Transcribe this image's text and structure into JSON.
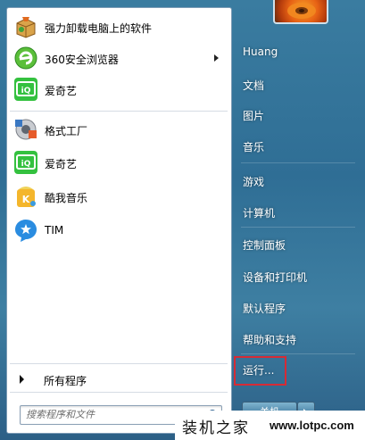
{
  "start_menu": {
    "programs": [
      {
        "label": "强力卸载电脑上的软件",
        "icon": "uninstaller-box-icon",
        "has_submenu": false
      },
      {
        "label": "360安全浏览器",
        "icon": "360-browser-icon",
        "has_submenu": true
      },
      {
        "label": "爱奇艺",
        "icon": "iqiyi-icon",
        "has_submenu": false
      },
      {
        "label": "格式工厂",
        "icon": "format-factory-icon",
        "has_submenu": false
      },
      {
        "label": "爱奇艺",
        "icon": "iqiyi-icon",
        "has_submenu": false
      },
      {
        "label": "酷我音乐",
        "icon": "kuwo-music-icon",
        "has_submenu": false
      },
      {
        "label": "TIM",
        "icon": "tim-icon",
        "has_submenu": false
      }
    ],
    "all_programs_label": "所有程序",
    "search": {
      "placeholder": "搜索程序和文件"
    },
    "right_links": [
      {
        "label": "Huang"
      },
      {
        "label": "文档"
      },
      {
        "label": "图片"
      },
      {
        "label": "音乐"
      },
      {
        "label": "游戏"
      },
      {
        "label": "计算机"
      },
      {
        "label": "控制面板"
      },
      {
        "label": "设备和打印机"
      },
      {
        "label": "默认程序"
      },
      {
        "label": "帮助和支持"
      },
      {
        "label": "运行..."
      }
    ],
    "shutdown_label": "关机",
    "highlighted_item": "运行...",
    "highlight_color": "#d62b35"
  },
  "watermark": {
    "text": "装机之家",
    "url": "www.lotpc.com"
  }
}
